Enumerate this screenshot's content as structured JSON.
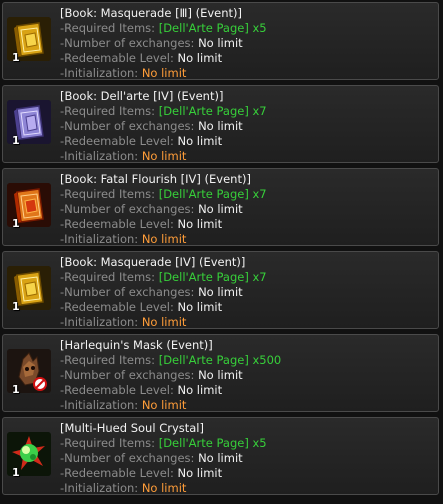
{
  "items": [
    {
      "name": "[Book: Masquerade [Ⅲ] (Event)]",
      "icon": "gold-book-icon",
      "quantity": "1",
      "required_label": "-Required Items: ",
      "required_value": "[Dell'Arte Page] x5",
      "exchanges_label": "-Number of exchanges: ",
      "exchanges_value": "No limit",
      "level_label": "-Redeemable Level: ",
      "level_value": "No limit",
      "init_label": "-Initialization: ",
      "init_value": "No limit"
    },
    {
      "name": "[Book: Dell'arte [IV] (Event)]",
      "icon": "purple-book-icon",
      "quantity": "1",
      "required_label": "-Required Items: ",
      "required_value": "[Dell'Arte Page] x7",
      "exchanges_label": "-Number of exchanges: ",
      "exchanges_value": "No limit",
      "level_label": "-Redeemable Level: ",
      "level_value": "No limit",
      "init_label": "-Initialization: ",
      "init_value": "No limit"
    },
    {
      "name": "[Book: Fatal Flourish [IV] (Event)]",
      "icon": "red-book-icon",
      "quantity": "1",
      "required_label": "-Required Items: ",
      "required_value": "[Dell'Arte Page] x7",
      "exchanges_label": "-Number of exchanges: ",
      "exchanges_value": "No limit",
      "level_label": "-Redeemable Level: ",
      "level_value": "No limit",
      "init_label": "-Initialization: ",
      "init_value": "No limit"
    },
    {
      "name": "[Book: Masquerade [IV] (Event)]",
      "icon": "gold-book-icon",
      "quantity": "1",
      "required_label": "-Required Items: ",
      "required_value": "[Dell'Arte Page] x7",
      "exchanges_label": "-Number of exchanges: ",
      "exchanges_value": "No limit",
      "level_label": "-Redeemable Level: ",
      "level_value": "No limit",
      "init_label": "-Initialization: ",
      "init_value": "No limit"
    },
    {
      "name": "[Harlequin's Mask (Event)]",
      "icon": "harlequin-mask-icon",
      "quantity": "1",
      "required_label": "-Required Items: ",
      "required_value": "[Dell'Arte Page] x500",
      "exchanges_label": "-Number of exchanges: ",
      "exchanges_value": "No limit",
      "level_label": "-Redeemable Level: ",
      "level_value": "No limit",
      "init_label": "-Initialization: ",
      "init_value": "No limit"
    },
    {
      "name": "[Multi-Hued Soul Crystal]",
      "icon": "soul-crystal-icon",
      "quantity": "1",
      "required_label": "-Required Items: ",
      "required_value": "[Dell'Arte Page] x5",
      "exchanges_label": "-Number of exchanges: ",
      "exchanges_value": "No limit",
      "level_label": "-Redeemable Level: ",
      "level_value": "No limit",
      "init_label": "-Initialization: ",
      "init_value": "No limit"
    }
  ]
}
